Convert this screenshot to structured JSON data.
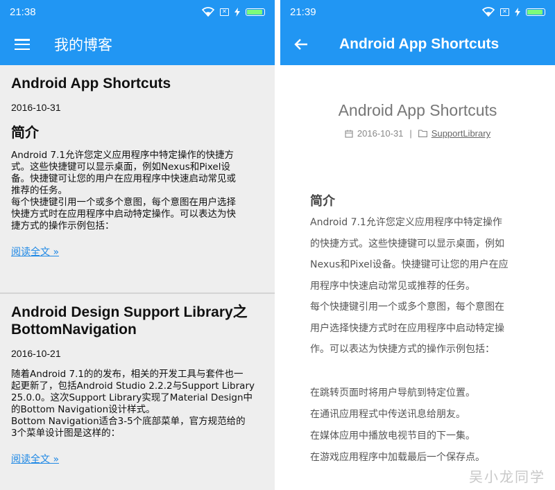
{
  "left": {
    "status_time": "21:38",
    "app_title": "我的博客",
    "posts": [
      {
        "title": "Android App Shortcuts",
        "date": "2016-10-31",
        "heading": "简介",
        "body_lines": [
          "Android 7.1允许您定义应用程序中特定操作的快捷方",
          "式。这些快捷键可以显示桌面，例如Nexus和Pixel设",
          "备。快捷键可让您的用户在应用程序中快速启动常见或",
          "推荐的任务。",
          "每个快捷键引用一个或多个意图，每个意图在用户选择",
          "快捷方式时在应用程序中启动特定操作。可以表达为快",
          "捷方式的操作示例包括："
        ],
        "read_more": "阅读全文 »"
      },
      {
        "title_lines": [
          "Android Design Support Library之",
          "BottomNavigation"
        ],
        "date": "2016-10-21",
        "body_lines": [
          "随着Android 7.1的的发布，相关的开发工具与套件也一",
          "起更新了，包括Android Studio 2.2.2与Support Library",
          "25.0.0。这次Support Library实现了Material Design中",
          "的Bottom Navigation设计样式。",
          "Bottom Navigation适合3-5个底部菜单，官方规范给的",
          "3个菜单设计图是这样的："
        ],
        "read_more": "阅读全文 »"
      }
    ]
  },
  "right": {
    "status_time": "21:39",
    "app_title": "Android App Shortcuts",
    "post": {
      "title": "Android App Shortcuts",
      "date": "2016-10-31",
      "separator": "|",
      "category": "SupportLibrary",
      "heading": "简介",
      "body_lines": [
        "Android 7.1允许您定义应用程序中特定操作",
        "的快捷方式。这些快捷键可以显示桌面，例如",
        "Nexus和Pixel设备。快捷键可让您的用户在应",
        "用程序中快速启动常见或推荐的任务。",
        "每个快捷键引用一个或多个意图，每个意图在",
        "用户选择快捷方式时在应用程序中启动特定操",
        "作。可以表达为快捷方式的操作示例包括："
      ],
      "examples": [
        "在跳转页面时将用户导航到特定位置。",
        "在通讯应用程式中传送讯息给朋友。",
        "在媒体应用中播放电视节目的下一集。",
        "在游戏应用程序中加载最后一个保存点。"
      ]
    },
    "watermark": "吴小龙同学"
  },
  "colors": {
    "primary": "#2196f3",
    "card_bg": "#eeeeee",
    "link": "#1e88e5",
    "battery": "#7cfc7c"
  },
  "icons": [
    "wifi-icon",
    "sim-off-icon",
    "charging-icon",
    "battery-icon",
    "hamburger-menu-icon",
    "back-arrow-icon",
    "calendar-icon",
    "folder-icon"
  ]
}
